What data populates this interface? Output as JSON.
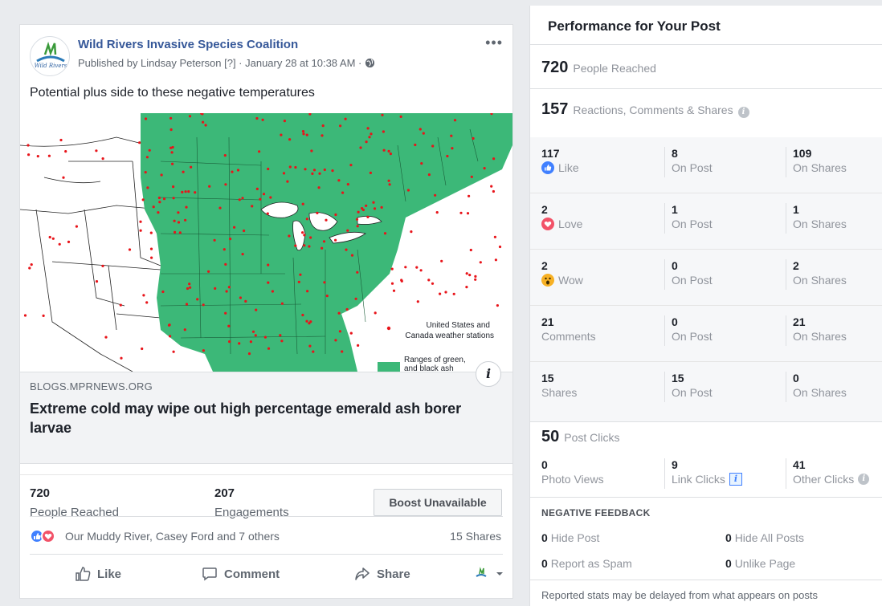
{
  "post": {
    "page_name": "Wild Rivers Invasive Species Coalition",
    "avatar_text": "Wild Rivers",
    "meta": "Published by Lindsay Peterson [?] · January 28 at 10:38 AM ·",
    "text": "Potential plus side to these negative temperatures",
    "more_label": "•••",
    "map_legend": {
      "stations": "United States and Canada weather stations",
      "stations_line1": "United States and",
      "stations_line2": "Canada weather stations",
      "ranges": "Ranges of green, white and black ash",
      "ranges_line1": "Ranges of green,",
      "ranges_line2": "and black ash"
    },
    "link": {
      "domain": "BLOGS.MPRNEWS.ORG",
      "title": "Extreme cold may wipe out high percentage emerald ash borer larvae",
      "info": "i"
    },
    "stats": {
      "reached_value": "720",
      "reached_label": "People Reached",
      "engagements_value": "207",
      "engagements_label": "Engagements",
      "boost_label": "Boost Unavailable"
    },
    "reactions": {
      "names": "Our Muddy River, Casey Ford and 7 others",
      "shares": "15 Shares"
    },
    "actions": {
      "like": "Like",
      "comment": "Comment",
      "share": "Share"
    }
  },
  "performance": {
    "title": "Performance for Your Post",
    "people_reached_value": "720",
    "people_reached_label": "People Reached",
    "engagement_value": "157",
    "engagement_label": "Reactions, Comments & Shares",
    "rows": [
      {
        "total": "117",
        "label": "Like",
        "on_post": "8",
        "on_post_label": "On Post",
        "on_shares": "109",
        "on_shares_label": "On Shares"
      },
      {
        "total": "2",
        "label": "Love",
        "on_post": "1",
        "on_post_label": "On Post",
        "on_shares": "1",
        "on_shares_label": "On Shares"
      },
      {
        "total": "2",
        "label": "Wow",
        "on_post": "0",
        "on_post_label": "On Post",
        "on_shares": "2",
        "on_shares_label": "On Shares"
      },
      {
        "total": "21",
        "label": "Comments",
        "on_post": "0",
        "on_post_label": "On Post",
        "on_shares": "21",
        "on_shares_label": "On Shares"
      },
      {
        "total": "15",
        "label": "Shares",
        "on_post": "15",
        "on_post_label": "On Post",
        "on_shares": "0",
        "on_shares_label": "On Shares"
      }
    ],
    "post_clicks_value": "50",
    "post_clicks_label": "Post Clicks",
    "clicks": {
      "photo_views_value": "0",
      "photo_views_label": "Photo Views",
      "link_clicks_value": "9",
      "link_clicks_label": "Link Clicks",
      "other_clicks_value": "41",
      "other_clicks_label": "Other Clicks"
    },
    "negative_feedback": {
      "title": "NEGATIVE FEEDBACK",
      "hide_post_value": "0",
      "hide_post_label": "Hide Post",
      "hide_all_value": "0",
      "hide_all_label": "Hide All Posts",
      "spam_value": "0",
      "spam_label": "Report as Spam",
      "unlike_value": "0",
      "unlike_label": "Unlike Page"
    },
    "footnote": "Reported stats may be delayed from what appears on posts"
  },
  "colors": {
    "link_blue": "#365899",
    "range_green": "#3cb878",
    "station_red": "#e8141a",
    "like_blue": "#4080ff",
    "love_red": "#f25268",
    "wow_yellow": "#f7b125"
  }
}
